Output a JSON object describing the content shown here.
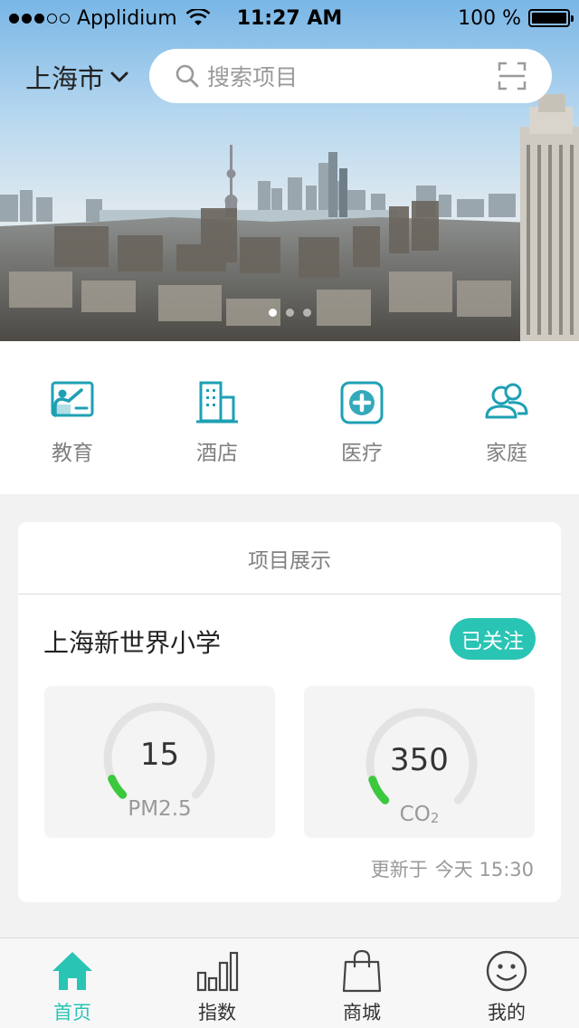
{
  "status_bar": {
    "carrier": "Applidium",
    "time": "11:27 AM",
    "battery": "100 %",
    "signal_bars_filled": 3,
    "signal_bars_total": 5
  },
  "header": {
    "city": "上海市",
    "search_placeholder": "搜索项目",
    "icons": [
      "chevron-down-icon",
      "search-icon",
      "scan-icon"
    ]
  },
  "banner": {
    "page_count": 3,
    "active_page": 1
  },
  "categories": [
    {
      "label": "教育",
      "icon": "education-icon"
    },
    {
      "label": "酒店",
      "icon": "hotel-icon"
    },
    {
      "label": "医疗",
      "icon": "medical-icon"
    },
    {
      "label": "家庭",
      "icon": "family-icon"
    }
  ],
  "project": {
    "section_title": "项目展示",
    "name": "上海新世界小学",
    "follow_label": "已关注",
    "gauges": [
      {
        "value": "15",
        "label": "PM2.5",
        "label_sub": "",
        "level": 0.08
      },
      {
        "value": "350",
        "label": "CO",
        "label_sub": "2",
        "level": 0.1
      }
    ],
    "updated_prefix": "更新于",
    "updated_time": "今天 15:30"
  },
  "tabs": [
    {
      "label": "首页",
      "icon": "home-icon",
      "active": true
    },
    {
      "label": "指数",
      "icon": "bar-chart-icon",
      "active": false
    },
    {
      "label": "商城",
      "icon": "shopping-bag-icon",
      "active": false
    },
    {
      "label": "我的",
      "icon": "smiley-icon",
      "active": false
    }
  ],
  "colors": {
    "accent": "#29c4b4",
    "icon_teal": "#1ea0b4",
    "gauge_ok": "#3cc83c",
    "gauge_track": "#e3e3e3"
  }
}
